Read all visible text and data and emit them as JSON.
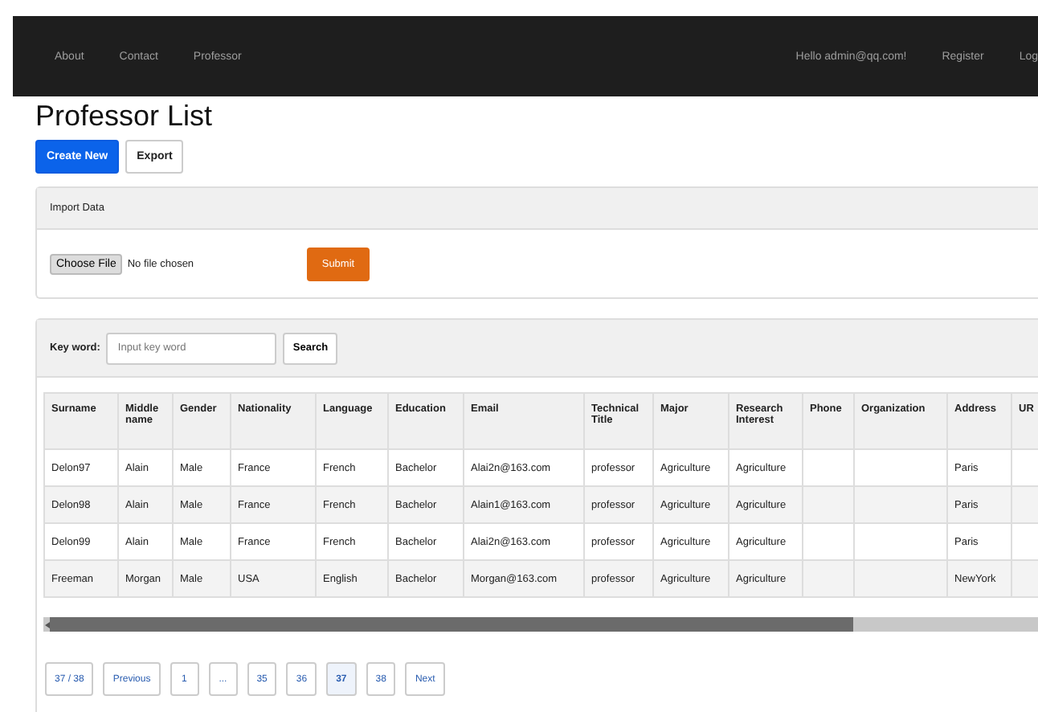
{
  "navbar": {
    "left_links": [
      "About",
      "Contact",
      "Professor"
    ],
    "right_links": [
      "Hello admin@qq.com!",
      "Register",
      "Log"
    ]
  },
  "page_title": "Professor List",
  "actions": [
    {
      "label": "Create New",
      "kind": "primary"
    },
    {
      "label": "Export",
      "kind": "default"
    }
  ],
  "import_panel": {
    "title": "Import Data",
    "file_button": "Choose File",
    "file_status": "No file chosen",
    "submit": "Submit"
  },
  "search": {
    "label": "Key word:",
    "placeholder": "Input key word",
    "button": "Search"
  },
  "table": {
    "columns": [
      "Surname",
      "Middle name",
      "Gender",
      "Nationality",
      "Language",
      "Education",
      "Email",
      "Technical Title",
      "Major",
      "Research Interest",
      "Phone",
      "Organization",
      "Address",
      "UR"
    ],
    "rows": [
      [
        "Delon97",
        "Alain",
        "Male",
        "France",
        "French",
        "Bachelor",
        "Alai2n@163.com",
        "professor",
        "Agriculture",
        "Agriculture",
        "",
        "",
        "Paris",
        ""
      ],
      [
        "Delon98",
        "Alain",
        "Male",
        "France",
        "French",
        "Bachelor",
        "Alain1@163.com",
        "professor",
        "Agriculture",
        "Agriculture",
        "",
        "",
        "Paris",
        ""
      ],
      [
        "Delon99",
        "Alain",
        "Male",
        "France",
        "French",
        "Bachelor",
        "Alai2n@163.com",
        "professor",
        "Agriculture",
        "Agriculture",
        "",
        "",
        "Paris",
        ""
      ],
      [
        "Freeman",
        "Morgan",
        "Male",
        "USA",
        "English",
        "Bachelor",
        "Morgan@163.com",
        "professor",
        "Agriculture",
        "Agriculture",
        "",
        "",
        "NewYork",
        ""
      ]
    ]
  },
  "pagination": [
    {
      "label": "37 / 38",
      "selected": false
    },
    {
      "label": "Previous",
      "selected": false
    },
    {
      "label": "1",
      "selected": false
    },
    {
      "label": "...",
      "selected": false
    },
    {
      "label": "35",
      "selected": false
    },
    {
      "label": "36",
      "selected": false
    },
    {
      "label": "37",
      "selected": true
    },
    {
      "label": "38",
      "selected": false
    },
    {
      "label": "Next",
      "selected": false
    }
  ]
}
